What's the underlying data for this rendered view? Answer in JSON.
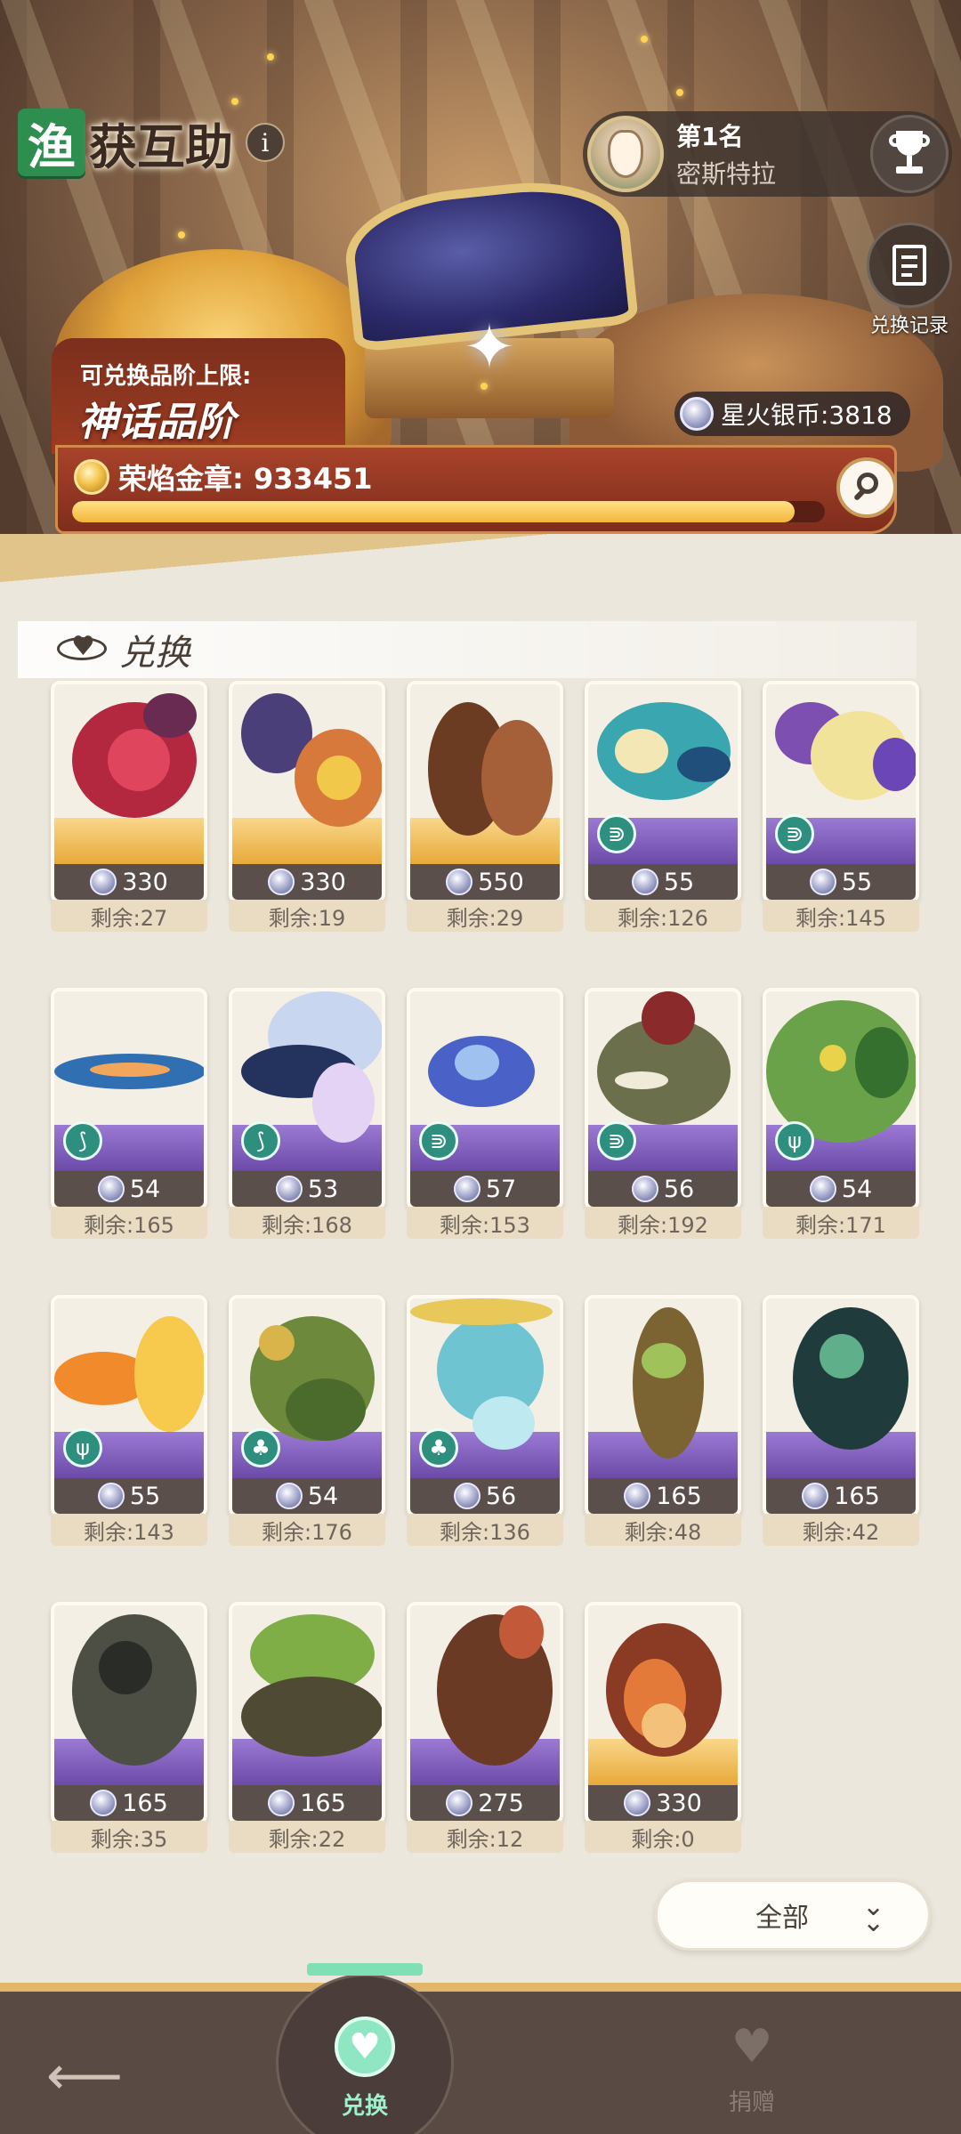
{
  "header": {
    "title_badge": "渔",
    "title_rest": "获互助",
    "info_icon": "i",
    "rank": {
      "place": "第1名",
      "name": "密斯特拉"
    },
    "record_label": "兑换记录",
    "tier_caption": "可兑换品阶上限:",
    "tier_value": "神话品阶",
    "silver": "星火银币:3818",
    "medal": "荣焰金章: 933451",
    "medal_progress": 0.96
  },
  "section_title": "兑换",
  "items": [
    {
      "price": "330",
      "remain": "剩余:27",
      "band": "gold",
      "type": "",
      "art": "berry"
    },
    {
      "price": "330",
      "remain": "剩余:19",
      "band": "gold",
      "type": "",
      "art": "gem"
    },
    {
      "price": "550",
      "remain": "剩余:29",
      "band": "gold",
      "type": "",
      "art": "wood"
    },
    {
      "price": "55",
      "remain": "剩余:126",
      "band": "purple",
      "type": "fish",
      "art": "fish-green"
    },
    {
      "price": "55",
      "remain": "剩余:145",
      "band": "purple",
      "type": "fish",
      "art": "fish-yellow"
    },
    {
      "price": "54",
      "remain": "剩余:165",
      "band": "purple",
      "type": "shrimp",
      "art": "eel"
    },
    {
      "price": "53",
      "remain": "剩余:168",
      "band": "purple",
      "type": "shrimp",
      "art": "flyfish"
    },
    {
      "price": "57",
      "remain": "剩余:153",
      "band": "purple",
      "type": "fish",
      "art": "fish-blue"
    },
    {
      "price": "56",
      "remain": "剩余:192",
      "band": "purple",
      "type": "fish",
      "art": "piranha"
    },
    {
      "price": "54",
      "remain": "剩余:171",
      "band": "purple",
      "type": "coral",
      "art": "bush"
    },
    {
      "price": "55",
      "remain": "剩余:143",
      "band": "purple",
      "type": "coral",
      "art": "goldfish"
    },
    {
      "price": "54",
      "remain": "剩余:176",
      "band": "purple",
      "type": "octopus",
      "art": "frog"
    },
    {
      "price": "56",
      "remain": "剩余:136",
      "band": "purple",
      "type": "octopus",
      "art": "lobster"
    },
    {
      "price": "165",
      "remain": "剩余:48",
      "band": "purple",
      "type": "",
      "art": "driftwood"
    },
    {
      "price": "165",
      "remain": "剩余:42",
      "band": "purple",
      "type": "",
      "art": "fern"
    },
    {
      "price": "165",
      "remain": "剩余:35",
      "band": "purple",
      "type": "",
      "art": "stump-dark"
    },
    {
      "price": "165",
      "remain": "剩余:22",
      "band": "purple",
      "type": "",
      "art": "stump-moss"
    },
    {
      "price": "275",
      "remain": "剩余:12",
      "band": "purple",
      "type": "",
      "art": "log"
    },
    {
      "price": "330",
      "remain": "剩余:0",
      "band": "gold",
      "type": "",
      "art": "crystal"
    }
  ],
  "filter": {
    "label": "全部",
    "icon": "double-chevron-down-icon"
  },
  "nav": {
    "back_icon": "back-arrow-icon",
    "exchange": "兑换",
    "donate": "捐赠"
  },
  "colors": {
    "accent_green": "#2e8e4f",
    "tab_active": "#9ff0cd",
    "medal_bar": "#a8432a"
  }
}
